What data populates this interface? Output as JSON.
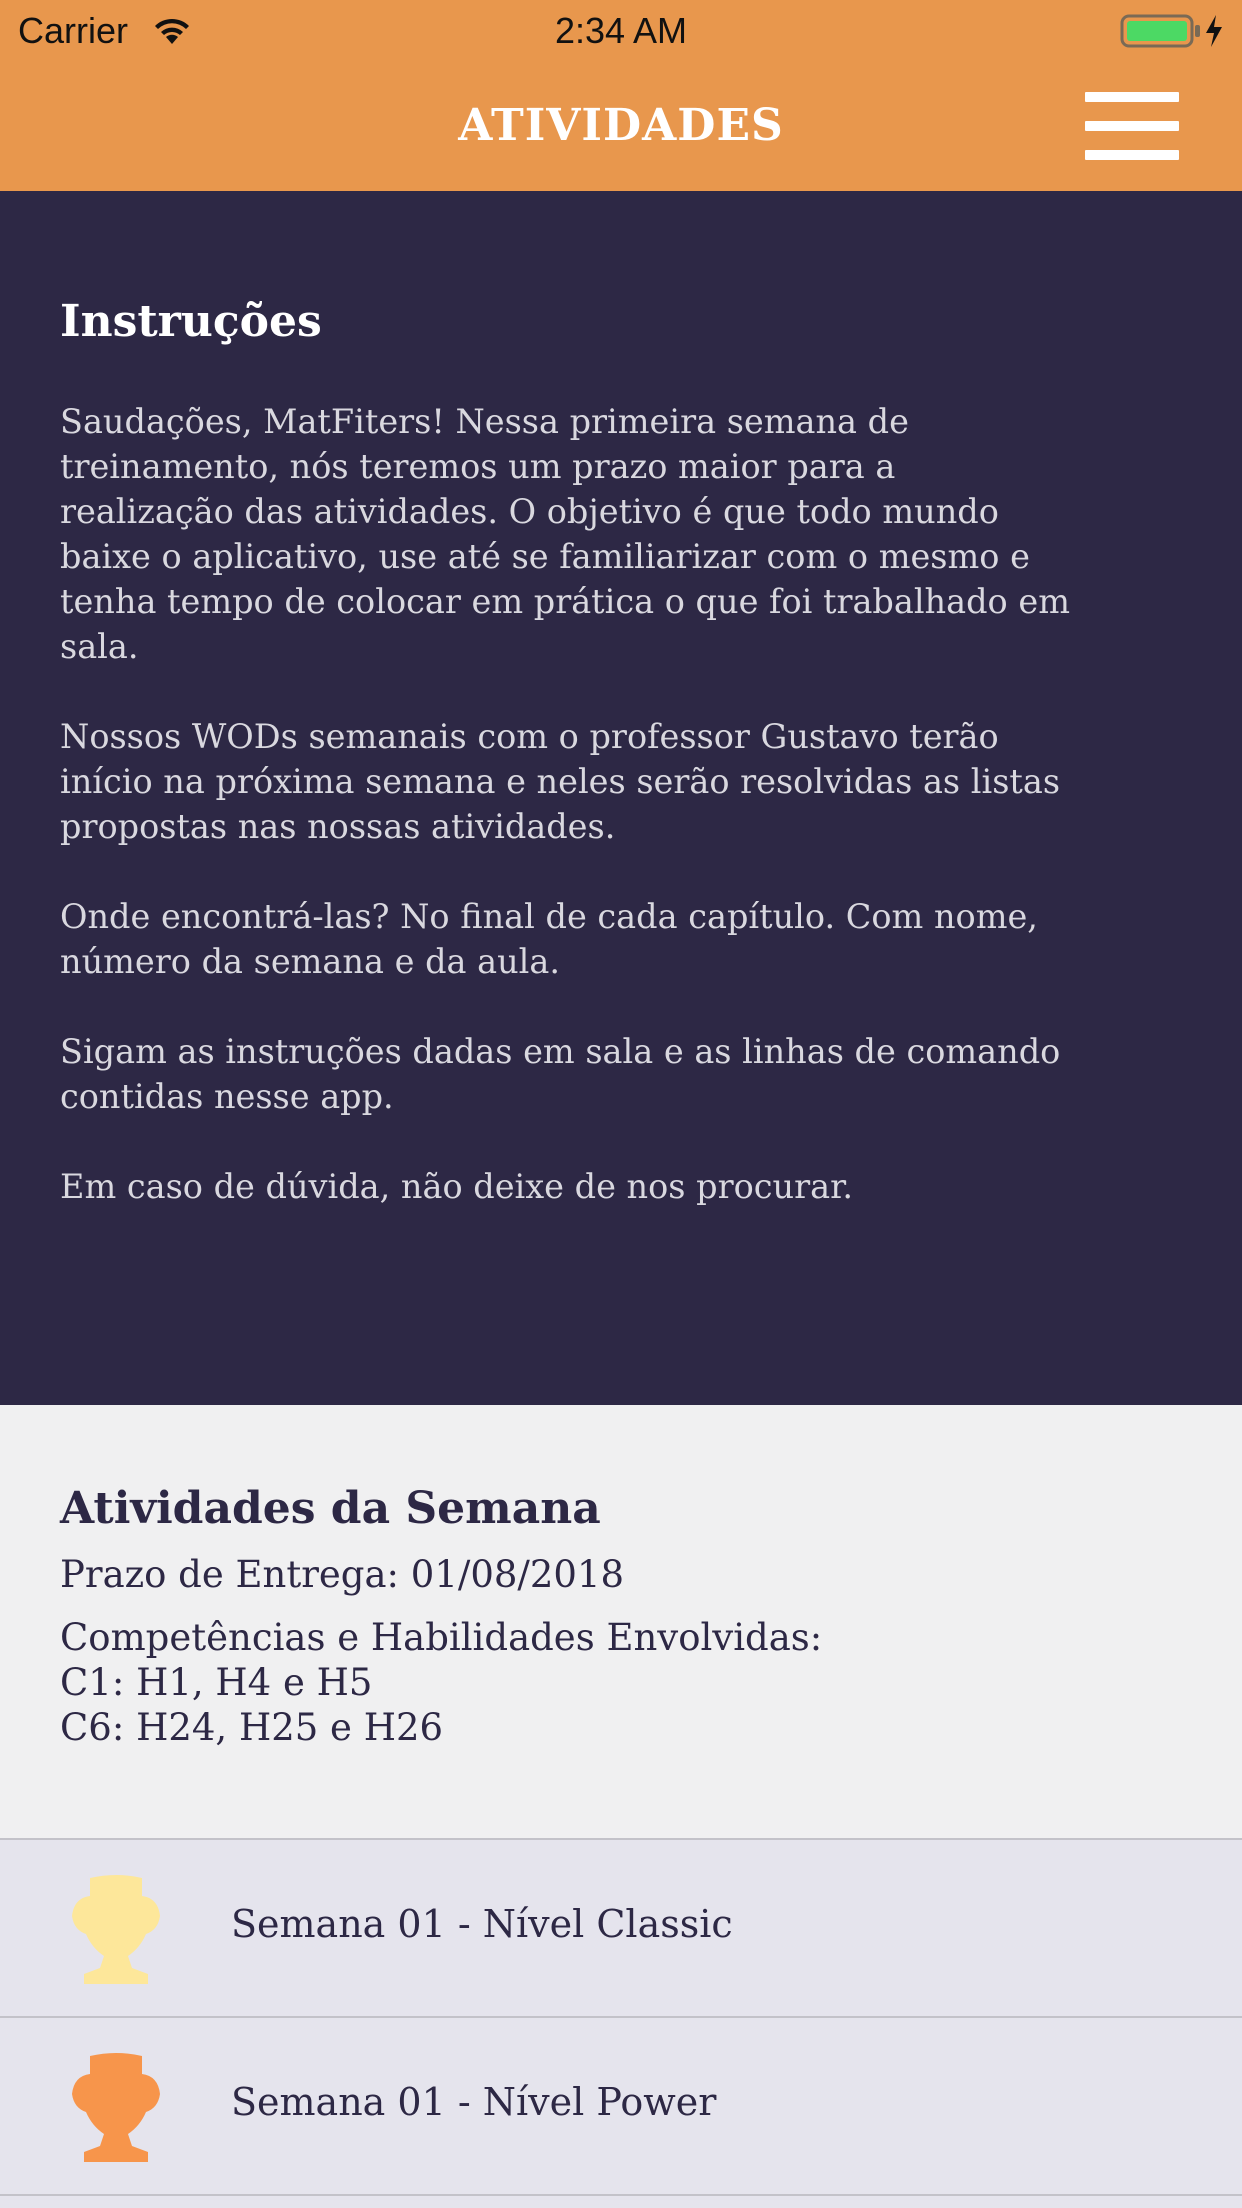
{
  "status_bar": {
    "carrier": "Carrier",
    "time": "2:34 AM",
    "wifi_icon": "wifi-icon",
    "battery_icon": "battery-charging-icon",
    "battery_color": "#4cd964"
  },
  "nav": {
    "title": "ATIVIDADES",
    "menu_icon": "hamburger-menu-icon",
    "background_color": "#e8974d"
  },
  "instructions": {
    "heading": "Instruções",
    "paragraphs": [
      "Saudações, MatFiters! Nessa primeira semana de\ntreinamento, nós teremos um prazo maior para a\nrealização das atividades. O objetivo é que todo mundo\nbaixe o aplicativo, use até se familiarizar com o mesmo e\ntenha tempo de colocar em prática o que foi trabalhado em\nsala.",
      "Nossos WODs semanais com o professor Gustavo terão\ninício na próxima semana e neles serão resolvidas as listas\npropostas nas nossas atividades.",
      "Onde encontrá-las? No final de cada capítulo. Com nome,\nnúmero da semana e da aula.",
      "Sigam as instruções dadas em sala e as linhas de comando\ncontidas nesse app.",
      "Em caso de dúvida, não deixe de nos procurar."
    ],
    "background_color": "#2d2845"
  },
  "week": {
    "heading": "Atividades da Semana",
    "deadline": "Prazo de Entrega: 01/08/2018",
    "competencies": [
      "Competências e Habilidades Envolvidas:",
      "C1: H1, H4 e H5",
      "C6: H24, H25 e H26"
    ]
  },
  "activities": [
    {
      "label": "Semana 01 - Nível Classic",
      "icon": "trophy-icon",
      "color": "#fde79a"
    },
    {
      "label": "Semana 01 - Nível Power",
      "icon": "trophy-icon",
      "color": "#f7954b"
    }
  ]
}
